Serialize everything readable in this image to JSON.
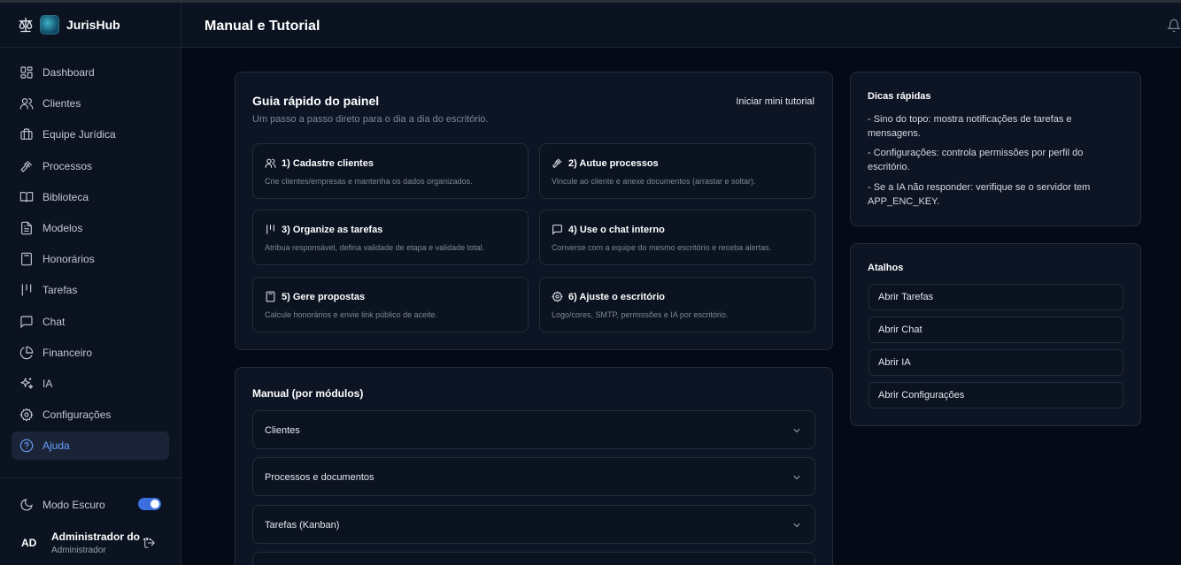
{
  "app": {
    "name": "JurisHub"
  },
  "header": {
    "title": "Manual e Tutorial"
  },
  "sidebar": {
    "items": [
      {
        "label": "Dashboard",
        "icon": "dashboard-icon"
      },
      {
        "label": "Clientes",
        "icon": "users-icon"
      },
      {
        "label": "Equipe Jurídica",
        "icon": "briefcase-icon"
      },
      {
        "label": "Processos",
        "icon": "gavel-icon"
      },
      {
        "label": "Biblioteca",
        "icon": "book-icon"
      },
      {
        "label": "Modelos",
        "icon": "file-icon"
      },
      {
        "label": "Honorários",
        "icon": "calculator-icon"
      },
      {
        "label": "Tarefas",
        "icon": "kanban-icon"
      },
      {
        "label": "Chat",
        "icon": "chat-icon"
      },
      {
        "label": "Financeiro",
        "icon": "pie-chart-icon"
      },
      {
        "label": "IA",
        "icon": "sparkles-icon"
      },
      {
        "label": "Configurações",
        "icon": "gear-icon"
      },
      {
        "label": "Ajuda",
        "icon": "help-icon",
        "active": true
      }
    ],
    "dark_mode_label": "Modo Escuro",
    "dark_mode_on": true,
    "user": {
      "initials": "AD",
      "name": "Administrador do ...",
      "role": "Administrador"
    }
  },
  "guide": {
    "title": "Guia rápido do painel",
    "subtitle": "Um passo a passo direto para o dia a dia do escritório.",
    "mini_tutorial_label": "Iniciar mini tutorial",
    "steps": [
      {
        "title": "1) Cadastre clientes",
        "desc": "Crie clientes/empresas e mantenha os dados organizados.",
        "icon": "users-icon"
      },
      {
        "title": "2) Autue processos",
        "desc": "Vincule ao cliente e anexe documentos (arrastar e soltar).",
        "icon": "gavel-icon"
      },
      {
        "title": "3) Organize as tarefas",
        "desc": "Atribua responsável, defina validade de etapa e validade total.",
        "icon": "kanban-icon"
      },
      {
        "title": "4) Use o chat interno",
        "desc": "Converse com a equipe do mesmo escritório e receba alertas.",
        "icon": "chat-icon"
      },
      {
        "title": "5) Gere propostas",
        "desc": "Calcule honorários e envie link público de aceite.",
        "icon": "calculator-icon"
      },
      {
        "title": "6) Ajuste o escritório",
        "desc": "Logo/cores, SMTP, permissões e IA por escritório.",
        "icon": "gear-icon"
      }
    ]
  },
  "manual": {
    "title": "Manual (por módulos)",
    "sections": [
      "Clientes",
      "Processos e documentos",
      "Tarefas (Kanban)"
    ]
  },
  "tips": {
    "title": "Dicas rápidas",
    "items": [
      "- Sino do topo: mostra notificações de tarefas e mensagens.",
      "- Configurações: controla permissões por perfil do escritório.",
      "- Se a IA não responder: verifique se o servidor tem APP_ENC_KEY."
    ]
  },
  "shortcuts": {
    "title": "Atalhos",
    "buttons": [
      "Abrir Tarefas",
      "Abrir Chat",
      "Abrir IA",
      "Abrir Configurações"
    ]
  },
  "colors": {
    "accent": "#6aa0ff",
    "toggle": "#3b6fe0",
    "background": "#050a16",
    "panel": "#0b1220"
  }
}
